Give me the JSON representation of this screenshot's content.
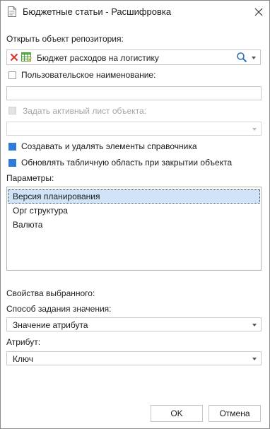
{
  "dialog": {
    "title": "Бюджетные статьи - Расшифровка",
    "close_icon": "close-icon",
    "title_icon": "document-icon"
  },
  "repository": {
    "label": "Открыть объект репозитория:",
    "value": "Бюджет расходов на логистику",
    "clear_icon": "red-x-icon",
    "object_icon": "grid-table-icon",
    "search_icon": "search-icon"
  },
  "custom_name": {
    "label": "Пользовательское наименование:",
    "checked": false,
    "value": ""
  },
  "active_sheet": {
    "label": "Задать активный лист объекта:",
    "checked": false,
    "enabled": false,
    "value": ""
  },
  "options": {
    "create_delete_label": "Создавать и удалять элементы справочника",
    "create_delete_checked": true,
    "refresh_label": "Обновлять табличную область при закрытии объекта",
    "refresh_checked": true
  },
  "params": {
    "label": "Параметры:",
    "items": [
      "Версия планирования",
      "Орг структура",
      "Валюта"
    ],
    "selected_index": 0
  },
  "selected_props": {
    "label": "Свойства выбранного:",
    "method_label": "Способ задания значения:",
    "method_value": "Значение атрибута",
    "attribute_label": "Атрибут:",
    "attribute_value": "Ключ"
  },
  "buttons": {
    "ok": "OK",
    "cancel": "Отмена"
  },
  "colors": {
    "accent": "#2f7bd8",
    "selection": "#cfe4f8",
    "border": "#c8c8c8"
  }
}
